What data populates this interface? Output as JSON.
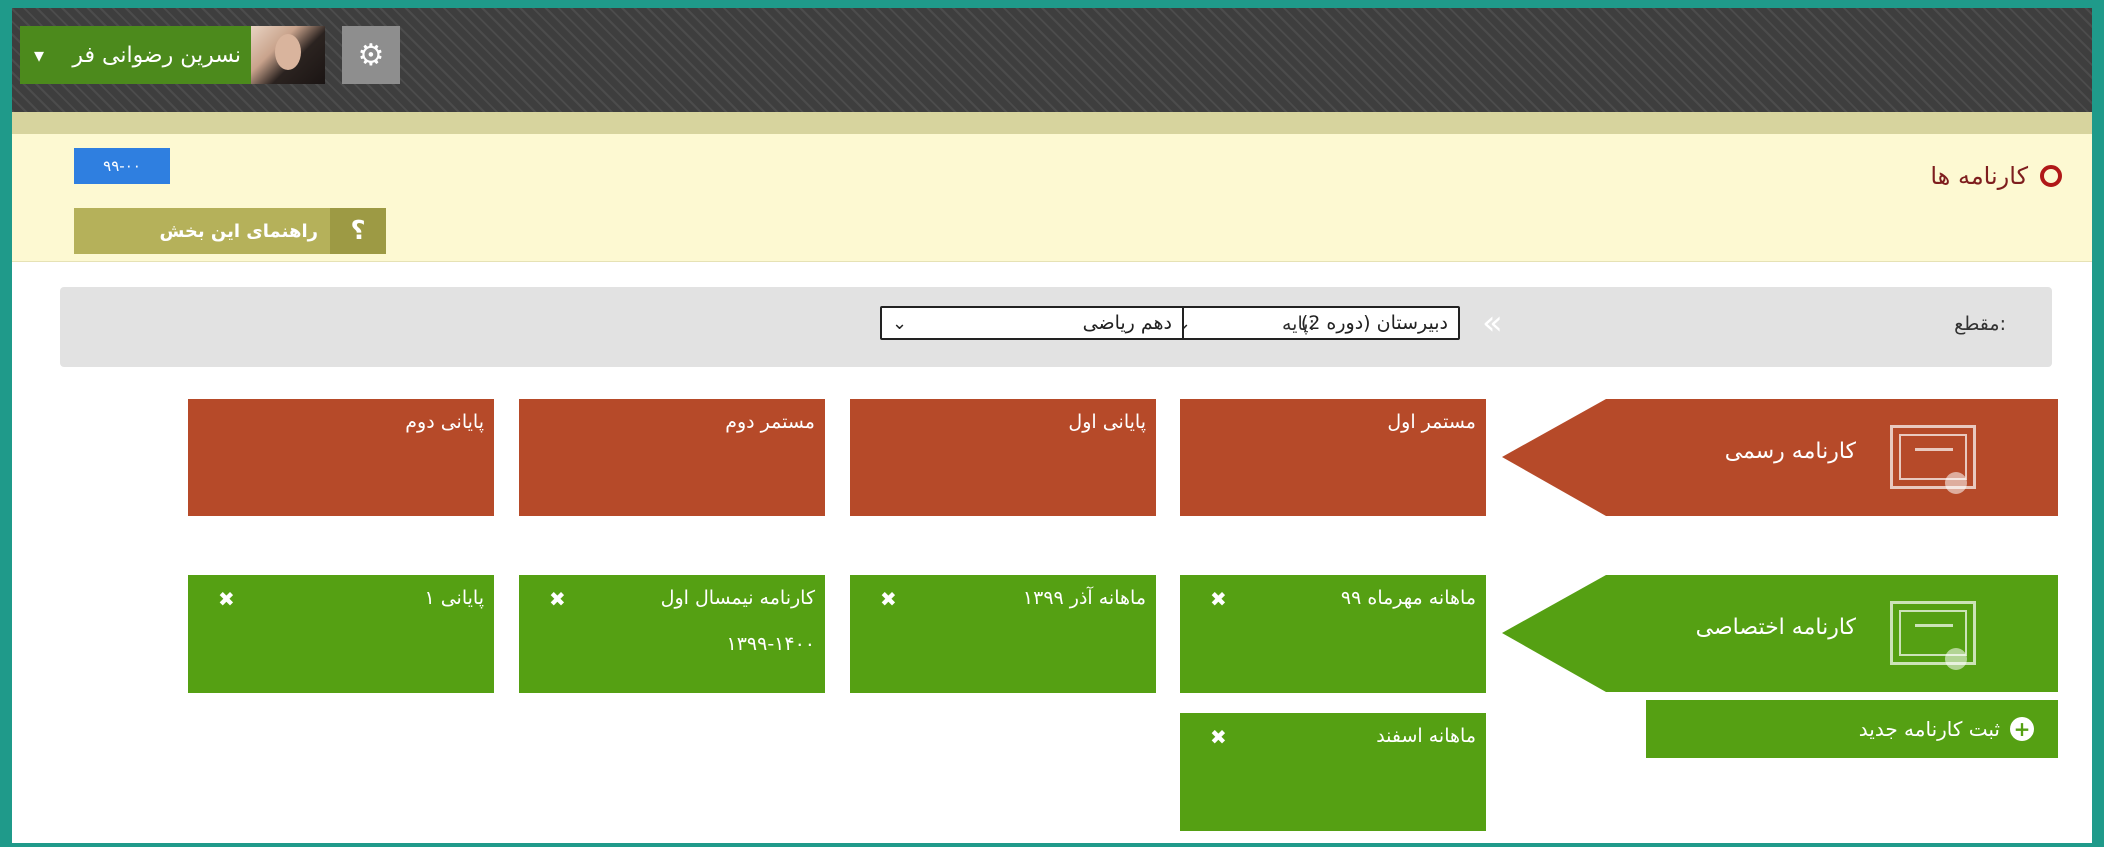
{
  "topbar": {
    "user_name": "نسرین رضوانی فر",
    "user_caret": "▾",
    "settings_icon": "gear-icon",
    "settings_glyph": "⚙"
  },
  "header": {
    "code_badge": "۹۹-۰۰",
    "help_label": "راهنمای این بخش",
    "help_glyph": "؟",
    "page_title": "کارنامه ها"
  },
  "filters": {
    "level_label": "مقطع:",
    "level_value": "دبیرستان (دوره 2)",
    "grade_label": "پایه:",
    "grade_value": "دهم ریاضی",
    "arrow_glyph": "«"
  },
  "official": {
    "label": "کارنامه رسمی",
    "tiles": [
      "مستمر اول",
      "پایانی اول",
      "مستمر دوم",
      "پایانی دوم"
    ],
    "color": "#b64a29"
  },
  "custom": {
    "label": "کارنامه اختصاصی",
    "tiles": [
      {
        "title": "ماهانه مهرماه ۹۹",
        "sub": ""
      },
      {
        "title": "ماهانه آذر ۱۳۹۹",
        "sub": ""
      },
      {
        "title": "کارنامه نیمسال اول",
        "sub": "۱۳۹۹-۱۴۰۰"
      },
      {
        "title": "پایانی ۱",
        "sub": ""
      },
      {
        "title": "ماهانه اسفند",
        "sub": ""
      }
    ],
    "close_glyph": "✖",
    "new_button": "ثبت کارنامه جدید",
    "new_glyph": "+",
    "color": "#55a013"
  }
}
